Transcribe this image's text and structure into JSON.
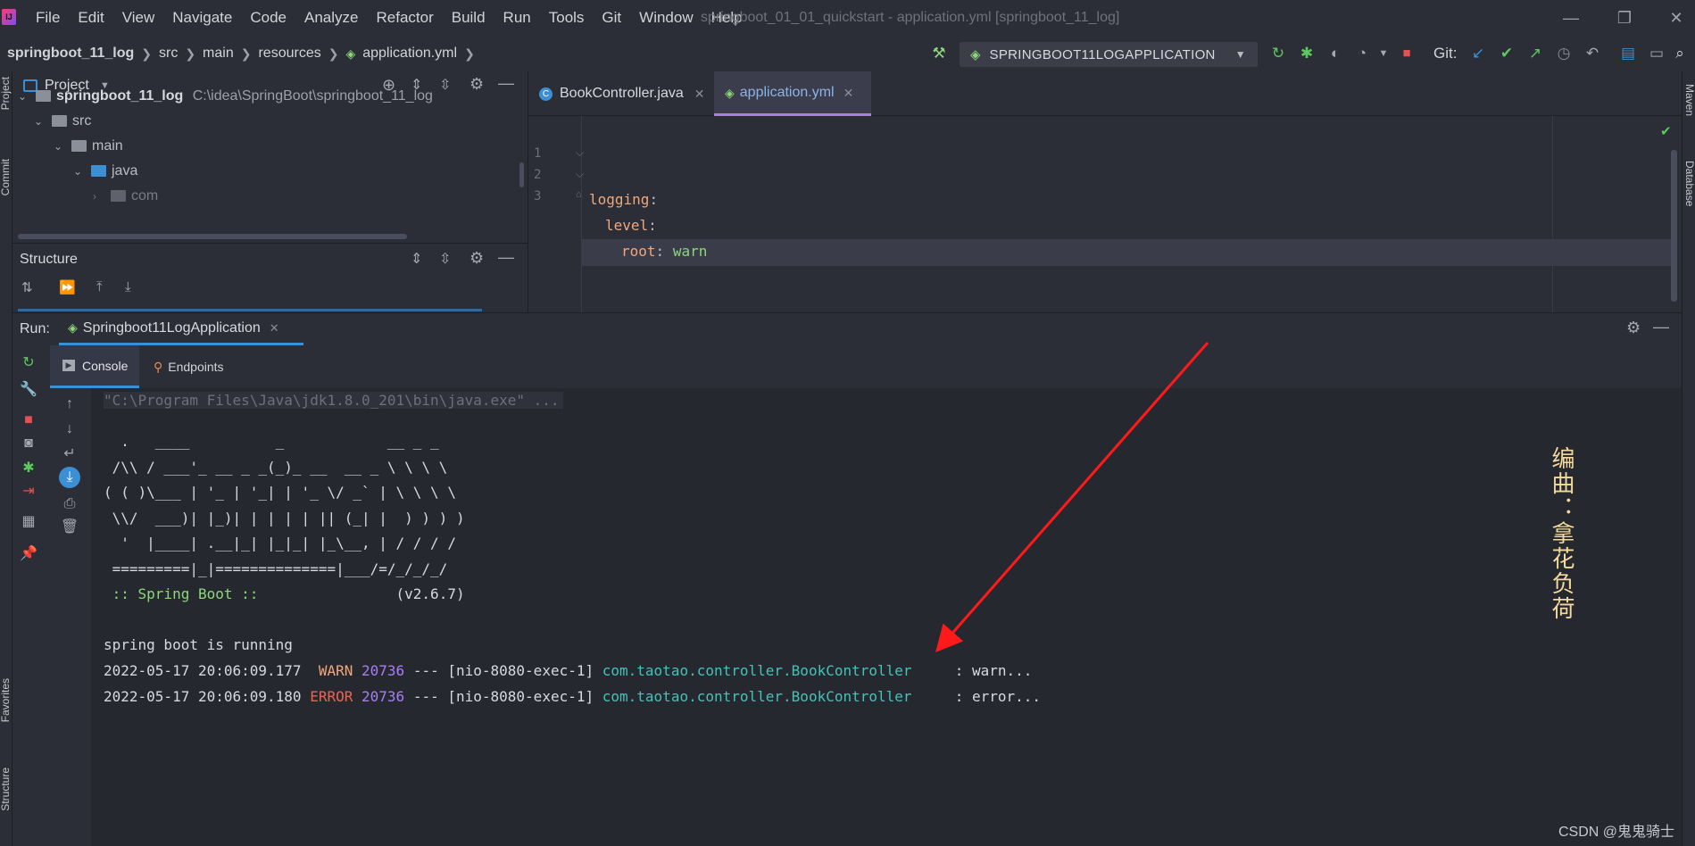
{
  "menubar": {
    "logo": "IJ",
    "items": [
      "File",
      "Edit",
      "View",
      "Navigate",
      "Code",
      "Analyze",
      "Refactor",
      "Build",
      "Run",
      "Tools",
      "Git",
      "Window",
      "Help"
    ],
    "window_title": "springboot_01_01_quickstart - application.yml [springboot_11_log]",
    "controls": [
      "—",
      "❐",
      "✕"
    ]
  },
  "navbar": {
    "breadcrumb": [
      "springboot_11_log",
      "src",
      "main",
      "resources",
      "application.yml"
    ],
    "run_config": "SPRINGBOOT11LOGAPPLICATION",
    "git_label": "Git:"
  },
  "left_strip": {
    "project": "Project",
    "commit": "Commit",
    "favorites": "Favorites",
    "structure": "Structure"
  },
  "right_strip": {
    "maven": "Maven",
    "database": "Database"
  },
  "project": {
    "title": "Project",
    "tree": [
      {
        "label": "springboot_11_log",
        "path": "C:\\idea\\SpringBoot\\springboot_11_log"
      },
      {
        "label": "src"
      },
      {
        "label": "main"
      },
      {
        "label": "java"
      },
      {
        "label": "com"
      }
    ]
  },
  "structure": {
    "title": "Structure"
  },
  "editor": {
    "tabs": [
      {
        "label": "BookController.java",
        "icon": "C"
      },
      {
        "label": "application.yml"
      }
    ],
    "line_numbers": [
      "1",
      "2",
      "3"
    ],
    "lines": [
      {
        "key": "logging",
        "colon": ":",
        "value": ""
      },
      {
        "key": "level",
        "colon": ":",
        "value": ""
      },
      {
        "key": "root",
        "colon": ":",
        "value": "warn"
      }
    ]
  },
  "run": {
    "label": "Run:",
    "config_tab": "Springboot11LogApplication",
    "tabs": [
      "Console",
      "Endpoints"
    ],
    "console": {
      "cmd": "\"C:\\Program Files\\Java\\jdk1.8.0_201\\bin\\java.exe\" ...",
      "banner": [
        "  .   ____          _            __ _ _",
        " /\\\\ / ___'_ __ _ _(_)_ __  __ _ \\ \\ \\ \\",
        "( ( )\\___ | '_ | '_| | '_ \\/ _` | \\ \\ \\ \\",
        " \\\\/  ___)| |_)| | | | | || (_| |  ) ) ) )",
        "  '  |____| .__|_| |_|_| |_\\__, | / / / /",
        " =========|_|==============|___/=/_/_/_/"
      ],
      "spring_label": " :: Spring Boot :: ",
      "spring_version": "               (v2.6.7)",
      "running": "spring boot is running",
      "logs": [
        {
          "ts": "2022-05-17 20:06:09.177",
          "level": " WARN",
          "pid": "20736",
          "mid": " --- [nio-8080-exec-1] ",
          "logger": "com.taotao.controller.BookController",
          "msg": "     : warn..."
        },
        {
          "ts": "2022-05-17 20:06:09.180",
          "level": "ERROR",
          "pid": "20736",
          "mid": " --- [nio-8080-exec-1] ",
          "logger": "com.taotao.controller.BookController",
          "msg": "     : error..."
        }
      ]
    }
  },
  "watermark": "编曲：拿花负荷",
  "csdn": "CSDN @鬼鬼骑士",
  "colors": {
    "accent": "#3d8fd4",
    "warn": "#f0a87a",
    "error": "#f0624d",
    "pid": "#a77ef0",
    "logger": "#44c2b8",
    "banner_green": "#8dd77a",
    "arrow": "#ff1a1a"
  }
}
